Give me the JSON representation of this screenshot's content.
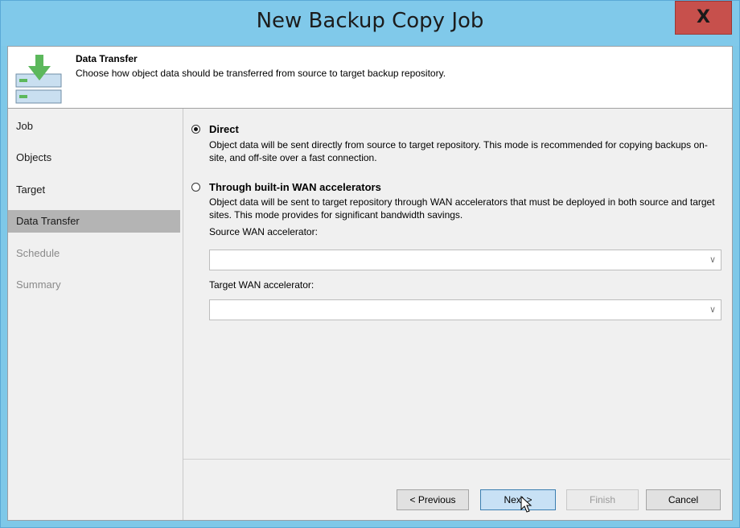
{
  "window": {
    "title": "New Backup Copy Job",
    "close_glyph": "X"
  },
  "header": {
    "title": "Data Transfer",
    "description": "Choose how object data should be transferred from source to target backup repository.",
    "icon": "download-to-repository-icon"
  },
  "sidebar": {
    "items": [
      {
        "label": "Job",
        "state": "normal"
      },
      {
        "label": "Objects",
        "state": "normal"
      },
      {
        "label": "Target",
        "state": "normal"
      },
      {
        "label": "Data Transfer",
        "state": "active"
      },
      {
        "label": "Schedule",
        "state": "disabled"
      },
      {
        "label": "Summary",
        "state": "disabled"
      }
    ]
  },
  "options": {
    "direct": {
      "label": "Direct",
      "selected": true,
      "description": "Object data will be sent directly from source to target repository. This mode is recommended for copying backups on-site, and off-site over a fast connection."
    },
    "wan": {
      "label": "Through built-in WAN accelerators",
      "selected": false,
      "description": "Object data will be sent to target repository through WAN accelerators that must be deployed in both source and target sites. This mode provides for significant bandwidth savings.",
      "source_label": "Source WAN accelerator:",
      "source_value": "",
      "target_label": "Target WAN accelerator:",
      "target_value": ""
    }
  },
  "buttons": {
    "previous": "< Previous",
    "next": "Next >",
    "finish": "Finish",
    "cancel": "Cancel"
  },
  "colors": {
    "title_bar": "#80c9ea",
    "close_button": "#c7504c",
    "active_nav": "#b4b4b4",
    "primary_button": "#c8e1f5"
  }
}
